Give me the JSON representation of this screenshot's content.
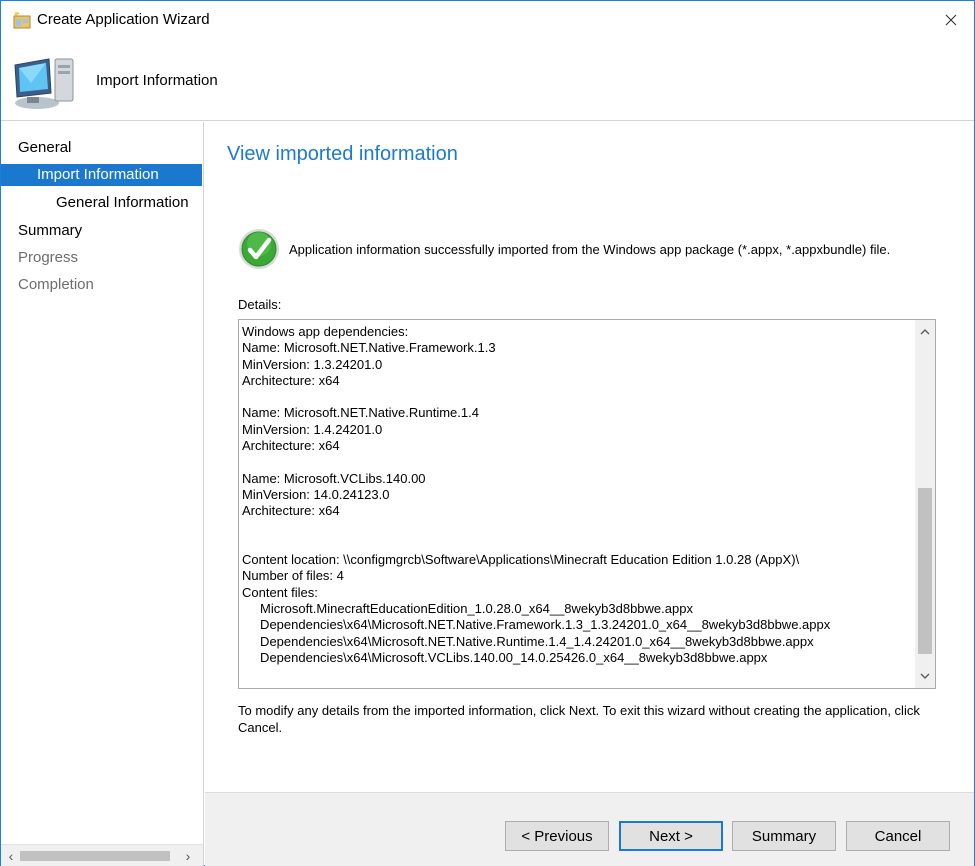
{
  "window": {
    "title": "Create Application Wizard"
  },
  "header": {
    "title": "Import Information"
  },
  "nav": {
    "items": [
      {
        "label": "General",
        "state": "normal",
        "indent": 0
      },
      {
        "label": "Import Information",
        "state": "selected",
        "indent": 1
      },
      {
        "label": "General Information",
        "state": "normal",
        "indent": 2
      },
      {
        "label": "Summary",
        "state": "normal",
        "indent": 0
      },
      {
        "label": "Progress",
        "state": "disabled",
        "indent": 0
      },
      {
        "label": "Completion",
        "state": "disabled",
        "indent": 0
      }
    ]
  },
  "main": {
    "title": "View imported information",
    "success_message": "Application information successfully imported from the Windows app package (*.appx, *.appxbundle) file.",
    "details_label": "Details:",
    "details_lines": [
      "Windows app dependencies:",
      "Name: Microsoft.NET.Native.Framework.1.3",
      "MinVersion: 1.3.24201.0",
      "Architecture: x64",
      "",
      "Name: Microsoft.NET.Native.Runtime.1.4",
      "MinVersion: 1.4.24201.0",
      "Architecture: x64",
      "",
      "Name: Microsoft.VCLibs.140.00",
      "MinVersion: 14.0.24123.0",
      "Architecture: x64",
      "",
      "",
      "Content location: \\\\configmgrcb\\Software\\Applications\\Minecraft Education Edition 1.0.28 (AppX)\\",
      "Number of files: 4",
      "Content files:",
      "     Microsoft.MinecraftEducationEdition_1.0.28.0_x64__8wekyb3d8bbwe.appx",
      "     Dependencies\\x64\\Microsoft.NET.Native.Framework.1.3_1.3.24201.0_x64__8wekyb3d8bbwe.appx",
      "     Dependencies\\x64\\Microsoft.NET.Native.Runtime.1.4_1.4.24201.0_x64__8wekyb3d8bbwe.appx",
      "     Dependencies\\x64\\Microsoft.VCLibs.140.00_14.0.25426.0_x64__8wekyb3d8bbwe.appx"
    ],
    "footer_note": "To modify any details from the imported information, click Next. To exit this wizard without creating the application, click Cancel."
  },
  "buttons": {
    "previous": "< Previous",
    "next": "Next >",
    "summary": "Summary",
    "cancel": "Cancel"
  },
  "colors": {
    "accent": "#1a7ad3",
    "selected_nav": "#1a78cf",
    "disabled_text": "#6d6d6d",
    "success_green": "#3aa935"
  }
}
